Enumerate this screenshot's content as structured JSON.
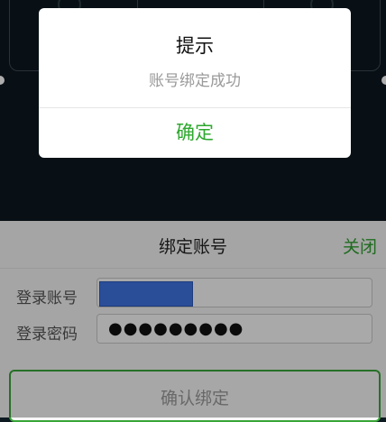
{
  "dialog": {
    "title": "提示",
    "message": "账号绑定成功",
    "ok_label": "确定"
  },
  "sheet": {
    "title": "绑定账号",
    "close_label": "关闭",
    "account_label": "登录账号",
    "account_value": "",
    "password_label": "登录密码",
    "password_value": "●●●●●●●●●",
    "confirm_label": "确认绑定"
  },
  "colors": {
    "accent_green": "#2ea82e",
    "background_dark": "#0d1921",
    "autofill_blue": "#3f73e0"
  }
}
